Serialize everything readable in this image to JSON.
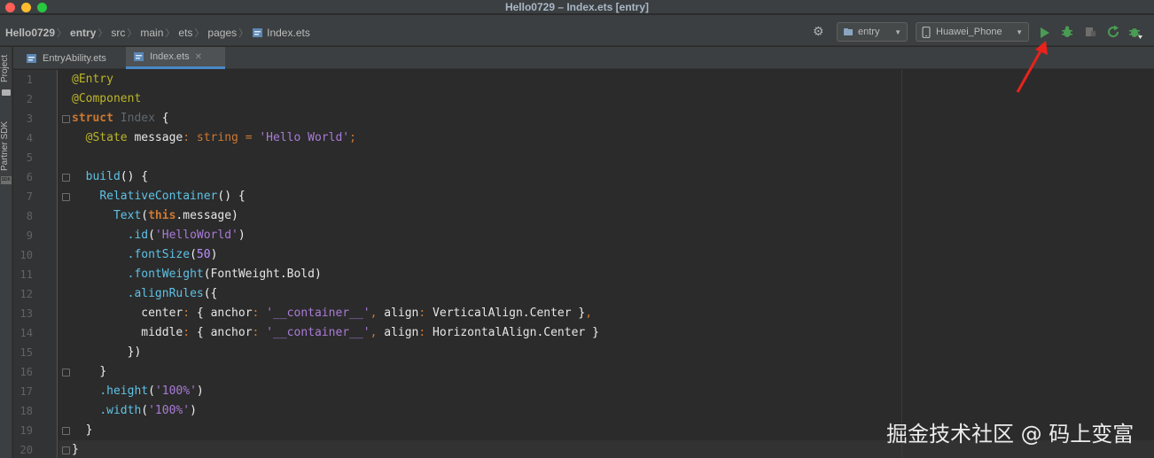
{
  "window": {
    "title": "Hello0729 – Index.ets [entry]"
  },
  "breadcrumb": [
    "Hello0729",
    "entry",
    "src",
    "main",
    "ets",
    "pages",
    "Index.ets"
  ],
  "toolbar": {
    "module_select": "entry",
    "device_select": "Huawei_Phone"
  },
  "toolstrip": {
    "project_label": "Project",
    "sdk_label": "Partner SDK",
    "sdk_badge": "SDK"
  },
  "tabs": [
    {
      "label": "EntryAbility.ets",
      "active": false
    },
    {
      "label": "Index.ets",
      "active": true
    }
  ],
  "line_numbers": [
    "1",
    "2",
    "3",
    "4",
    "5",
    "6",
    "7",
    "8",
    "9",
    "10",
    "11",
    "12",
    "13",
    "14",
    "15",
    "16",
    "17",
    "18",
    "19",
    "20"
  ],
  "code_lines": [
    "@Entry",
    "@Component",
    "struct Index {",
    "  @State message: string = 'Hello World';",
    "",
    "  build() {",
    "    RelativeContainer() {",
    "      Text(this.message)",
    "        .id('HelloWorld')",
    "        .fontSize(50)",
    "        .fontWeight(FontWeight.Bold)",
    "        .alignRules({",
    "          center: { anchor: '__container__', align: VerticalAlign.Center },",
    "          middle: { anchor: '__container__', align: HorizontalAlign.Center }",
    "        })",
    "    }",
    "    .height('100%')",
    "    .width('100%')",
    "  }",
    "}"
  ],
  "watermark": "掘金技术社区 @ 码上变富",
  "colors": {
    "accent": "#4a88c7",
    "run_green": "#499c54",
    "annotation_arrow": "#e8231c"
  }
}
